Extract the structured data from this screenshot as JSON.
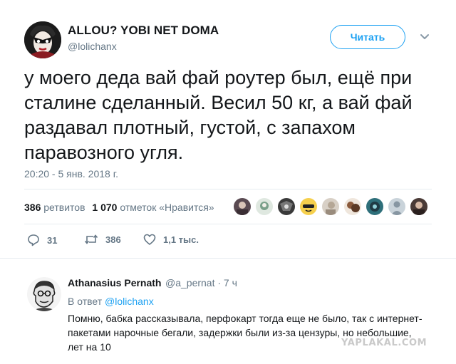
{
  "author": {
    "name": "ALLOU? YOBI NET DOMA",
    "handle": "@lolichanx"
  },
  "follow_label": "Читать",
  "tweet": {
    "lines": [
      "у моего деда вай фай роутер был, ещё при",
      "сталине сделанный. Весил 50 кг, а вай фай",
      "раздавал плотный, густой, с запахом",
      "паравозного угля."
    ],
    "timestamp": "20:20 - 5 янв. 2018 г."
  },
  "stats": {
    "retweets_count": "386",
    "retweets_label": "ретвитов",
    "likes_count": "1 070",
    "likes_label": "отметок «Нравится»"
  },
  "likers": [
    {
      "icon": "avatar-1",
      "color": "#5a4a52"
    },
    {
      "icon": "avatar-2",
      "color": "#7aa08a"
    },
    {
      "icon": "avatar-3",
      "color": "#3a3a3a"
    },
    {
      "icon": "avatar-4",
      "color": "#e8b437"
    },
    {
      "icon": "avatar-5",
      "color": "#c9bfb2"
    },
    {
      "icon": "avatar-6",
      "color": "#8a5a3c"
    },
    {
      "icon": "avatar-7",
      "color": "#2e6f7a"
    },
    {
      "icon": "avatar-8",
      "color": "#a8b4bd"
    },
    {
      "icon": "avatar-9",
      "color": "#4a3a36"
    }
  ],
  "actions": {
    "replies": "31",
    "retweets": "386",
    "likes": "1,1 тыс."
  },
  "reply": {
    "name": "Athanasius Pernath",
    "handle_time": "@a_pernat · 7 ч",
    "in_reply_prefix": "В ответ",
    "in_reply_link": "@lolichanx",
    "lines": [
      "Помню, бабка рассказывала, перфокарт тогда еще не было, так с интернет-",
      "пакетами нарочные бегали, задержки были из-за цензуры, но небольшие,",
      "лет на 10"
    ]
  },
  "watermark": "YAPLAKAL.COM",
  "colors": {
    "accent": "#1da1f2",
    "muted": "#657786",
    "text": "#14171a"
  }
}
